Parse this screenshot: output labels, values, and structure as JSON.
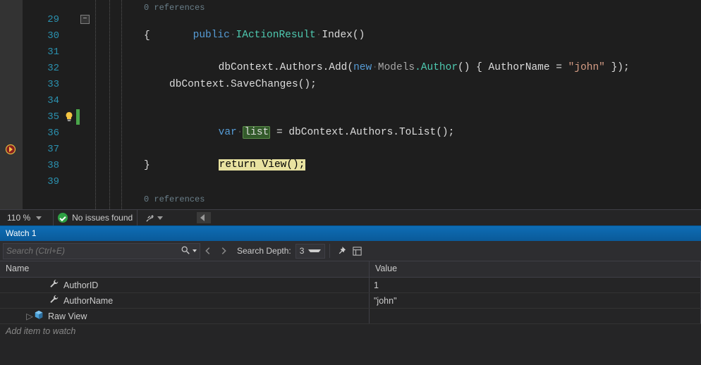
{
  "editor": {
    "references_label": "0 references",
    "lines": [
      {
        "n": 29
      },
      {
        "n": 30
      },
      {
        "n": 31
      },
      {
        "n": 32
      },
      {
        "n": 33
      },
      {
        "n": 34
      },
      {
        "n": 35
      },
      {
        "n": 36
      },
      {
        "n": 37
      },
      {
        "n": 38
      },
      {
        "n": 39
      }
    ],
    "code": {
      "l29": {
        "kw1": "public",
        "type": "IActionResult",
        "method": "Index",
        "parens": "()"
      },
      "l30": {
        "brace": "{"
      },
      "l31": {
        "obj": "dbContext",
        "m1": ".Authors.Add(",
        "kw": "new",
        "ns": "Models",
        "cls": ".Author",
        "p": "() { ",
        "prop": "AuthorName",
        "eq": " = ",
        "str": "\"john\"",
        "end": " });"
      },
      "l33": {
        "txt": "dbContext.SaveChanges();"
      },
      "l35": {
        "kw": "var",
        "varname": "list",
        "eq": " = dbContext.Authors.ToList();"
      },
      "l37": {
        "kw": "return",
        "rest": " View();"
      },
      "l38": {
        "brace": "}"
      }
    },
    "references_label_bottom": "0 references"
  },
  "status": {
    "zoom": "110 %",
    "issues": "No issues found"
  },
  "watch": {
    "title": "Watch 1",
    "search_placeholder": "Search (Ctrl+E)",
    "depth_label": "Search Depth:",
    "depth_value": "3",
    "cols": {
      "name": "Name",
      "value": "Value"
    },
    "rows": [
      {
        "icon": "wrench",
        "name": "AuthorID",
        "value": "1"
      },
      {
        "icon": "wrench",
        "name": "AuthorName",
        "value": "\"john\""
      },
      {
        "icon": "cube",
        "name": "Raw View",
        "value": "",
        "expandable": true
      }
    ],
    "add_item": "Add item to watch"
  }
}
